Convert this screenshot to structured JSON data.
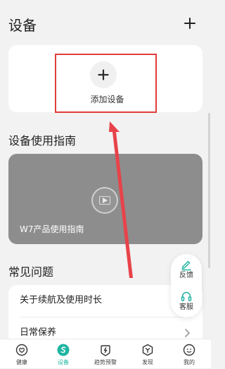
{
  "header": {
    "title": "设备",
    "add_icon": "plus-icon"
  },
  "add_device": {
    "label": "添加设备",
    "icon": "plus-icon"
  },
  "guide": {
    "title": "设备使用指南",
    "video_caption": "W7产品使用指南",
    "play_icon": "play-icon"
  },
  "faq": {
    "title": "常见问题",
    "items": [
      {
        "label": "关于续航及使用时长"
      },
      {
        "label": "日常保养"
      }
    ]
  },
  "floating": {
    "feedback_label": "反馈",
    "service_label": "客服",
    "feedback_icon": "edit-icon",
    "service_icon": "headset-icon"
  },
  "tabs": [
    {
      "label": "健康",
      "icon": "heart-icon",
      "active": false
    },
    {
      "label": "设备",
      "icon": "device-s-icon",
      "active": true
    },
    {
      "label": "趋势预警",
      "icon": "trend-alert-icon",
      "active": false
    },
    {
      "label": "发现",
      "icon": "discover-icon",
      "active": false
    },
    {
      "label": "我的",
      "icon": "profile-icon",
      "active": false
    }
  ],
  "colors": {
    "accent": "#1fb5a1",
    "annotation_red": "#e23b3b",
    "page_bg": "#f2f2f2",
    "card_bg": "#ffffff",
    "video_bg": "#8d8d8d"
  }
}
